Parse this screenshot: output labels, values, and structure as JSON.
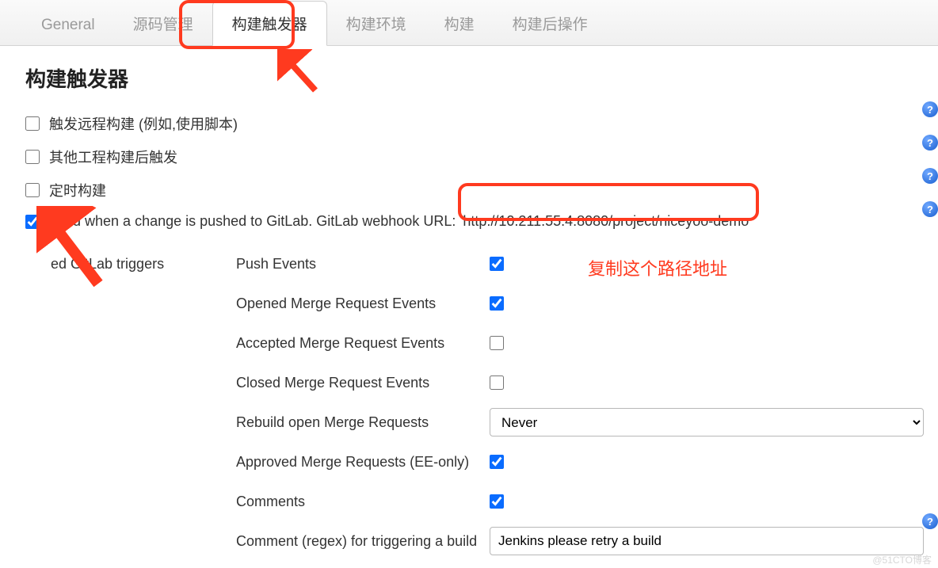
{
  "tabs": {
    "general": "General",
    "scm": "源码管理",
    "triggers": "构建触发器",
    "env": "构建环境",
    "build": "构建",
    "post": "构建后操作"
  },
  "section_title": "构建触发器",
  "options": {
    "remote": "触发远程构建 (例如,使用脚本)",
    "after_other": "其他工程构建后触发",
    "cron": "定时构建",
    "gitlab_prefix": "Build when a change is pushed to GitLab. GitLab webhook URL:",
    "gitlab_url": "http://10.211.55.4:8080/project/niceyoo-demo"
  },
  "triggers": {
    "group_label": "ed GitLab triggers",
    "push": "Push Events",
    "opened_mr": "Opened Merge Request Events",
    "accepted_mr": "Accepted Merge Request Events",
    "closed_mr": "Closed Merge Request Events",
    "rebuild_open": "Rebuild open Merge Requests",
    "rebuild_open_selected": "Never",
    "approved_mr": "Approved Merge Requests (EE-only)",
    "comments": "Comments",
    "comment_regex_label": "Comment (regex) for triggering a build",
    "comment_regex_value": "Jenkins please retry a build"
  },
  "annotations": {
    "copy_hint": "复制这个路径地址"
  },
  "watermark": "@51CTO博客"
}
